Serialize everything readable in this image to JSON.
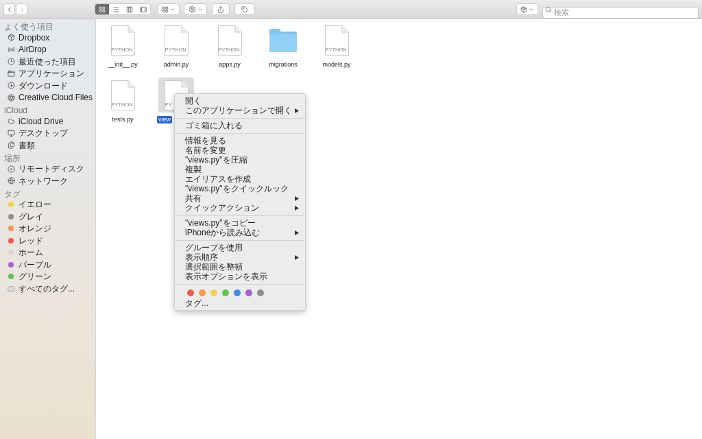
{
  "toolbar": {
    "view_buttons": [
      {
        "selected": true
      },
      {
        "selected": false
      },
      {
        "selected": false
      },
      {
        "selected": false
      }
    ],
    "search": {
      "placeholder": "検索"
    }
  },
  "sidebar": {
    "sections": [
      {
        "title": "よく使う項目",
        "items": [
          {
            "label": "Dropbox"
          },
          {
            "label": "AirDrop"
          },
          {
            "label": "最近使った項目"
          },
          {
            "label": "アプリケーション"
          },
          {
            "label": "ダウンロード"
          },
          {
            "label": "Creative Cloud Files"
          }
        ]
      },
      {
        "title": "iCloud",
        "items": [
          {
            "label": "iCloud Drive"
          },
          {
            "label": "デスクトップ"
          },
          {
            "label": "書類"
          }
        ]
      },
      {
        "title": "場所",
        "items": [
          {
            "label": "リモートディスク"
          },
          {
            "label": "ネットワーク"
          }
        ]
      },
      {
        "title": "タグ",
        "kind": "tags",
        "items": [
          {
            "label": "イエロー",
            "color": "#f5cf4f"
          },
          {
            "label": "グレイ",
            "color": "#8e8e93"
          },
          {
            "label": "オレンジ",
            "color": "#f39a45"
          },
          {
            "label": "レッド",
            "color": "#ec5a4f"
          },
          {
            "label": "ホーム",
            "color": "#ddd6cc"
          },
          {
            "label": "パープル",
            "color": "#a660d0"
          },
          {
            "label": "グリーン",
            "color": "#62c454"
          },
          {
            "label": "すべてのタグ...",
            "kind": "all"
          }
        ]
      }
    ]
  },
  "files": [
    {
      "name": "__init__.py",
      "kind": "python",
      "badge": "PYTHON",
      "selected": false
    },
    {
      "name": "admin.py",
      "kind": "python",
      "badge": "PYTHON",
      "selected": false
    },
    {
      "name": "apps.py",
      "kind": "python",
      "badge": "PYTHON",
      "selected": false
    },
    {
      "name": "migrations",
      "kind": "folder",
      "selected": false
    },
    {
      "name": "models.py",
      "kind": "python",
      "badge": "PYTHON",
      "selected": false
    },
    {
      "name": "tests.py",
      "kind": "python",
      "badge": "PYTHON",
      "selected": false
    },
    {
      "name": "view",
      "kind": "python",
      "badge": "PY",
      "selected": true
    }
  ],
  "context_menu": {
    "groups": [
      [
        {
          "label": "開く",
          "submenu": false
        },
        {
          "label": "このアプリケーションで開く",
          "submenu": true
        }
      ],
      [
        {
          "label": "ゴミ箱に入れる",
          "submenu": false
        }
      ],
      [
        {
          "label": "情報を見る",
          "submenu": false
        },
        {
          "label": "名前を変更",
          "submenu": false
        },
        {
          "label": "\"views.py\"を圧縮",
          "submenu": false
        },
        {
          "label": "複製",
          "submenu": false
        },
        {
          "label": "エイリアスを作成",
          "submenu": false
        },
        {
          "label": "\"views.py\"をクイックルック",
          "submenu": false
        },
        {
          "label": "共有",
          "submenu": true
        },
        {
          "label": "クイックアクション",
          "submenu": true
        }
      ],
      [
        {
          "label": "\"views.py\"をコピー",
          "submenu": false
        },
        {
          "label": "iPhoneから読み込む",
          "submenu": true
        }
      ],
      [
        {
          "label": "グループを使用",
          "submenu": false
        },
        {
          "label": "表示順序",
          "submenu": true
        },
        {
          "label": "選択範囲を整頓",
          "submenu": false
        },
        {
          "label": "表示オプションを表示",
          "submenu": false
        }
      ]
    ],
    "tag_colors": [
      {
        "color": "#ec5a4f"
      },
      {
        "color": "#f39a45"
      },
      {
        "color": "#f5cf4f"
      },
      {
        "color": "#62c454"
      },
      {
        "color": "#3f8cf5"
      },
      {
        "color": "#a660d0"
      },
      {
        "color": "#8e8e93"
      }
    ],
    "tags_item": "タグ..."
  }
}
